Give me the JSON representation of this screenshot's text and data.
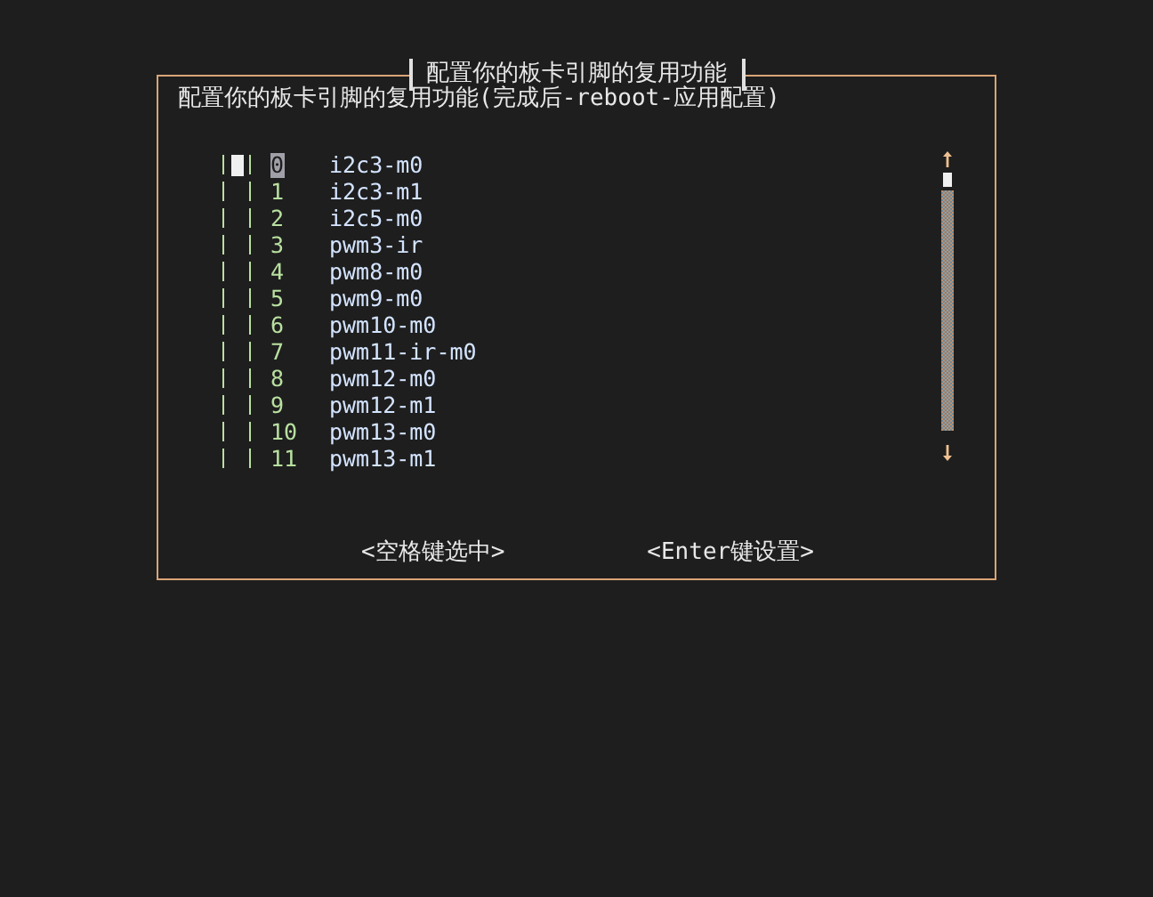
{
  "dialog": {
    "title": "配置你的板卡引脚的复用功能",
    "prompt": "配置你的板卡引脚的复用功能(完成后-reboot-应用配置)"
  },
  "items": [
    {
      "number": "0",
      "label": "i2c3-m0",
      "checked": false,
      "selected": true
    },
    {
      "number": "1",
      "label": "i2c3-m1",
      "checked": false,
      "selected": false
    },
    {
      "number": "2",
      "label": "i2c5-m0",
      "checked": false,
      "selected": false
    },
    {
      "number": "3",
      "label": "pwm3-ir",
      "checked": false,
      "selected": false
    },
    {
      "number": "4",
      "label": "pwm8-m0",
      "checked": false,
      "selected": false
    },
    {
      "number": "5",
      "label": "pwm9-m0",
      "checked": false,
      "selected": false
    },
    {
      "number": "6",
      "label": "pwm10-m0",
      "checked": false,
      "selected": false
    },
    {
      "number": "7",
      "label": "pwm11-ir-m0",
      "checked": false,
      "selected": false
    },
    {
      "number": "8",
      "label": "pwm12-m0",
      "checked": false,
      "selected": false
    },
    {
      "number": "9",
      "label": "pwm12-m1",
      "checked": false,
      "selected": false
    },
    {
      "number": "10",
      "label": "pwm13-m0",
      "checked": false,
      "selected": false
    },
    {
      "number": "11",
      "label": "pwm13-m1",
      "checked": false,
      "selected": false
    }
  ],
  "buttons": [
    {
      "label": "<空格键选中>"
    },
    {
      "label": "<Enter键设置>"
    }
  ]
}
